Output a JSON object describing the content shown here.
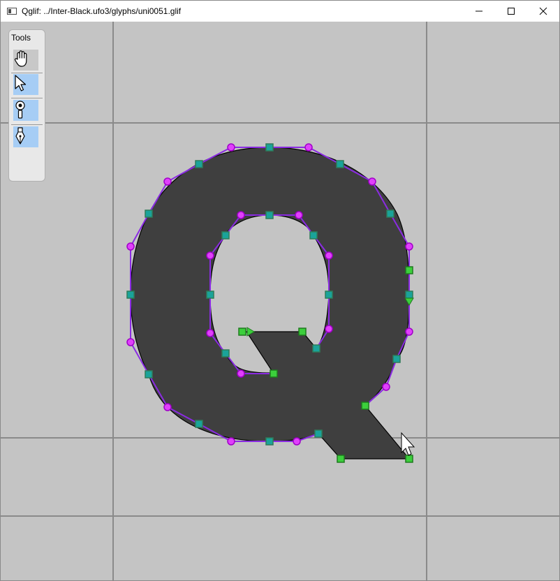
{
  "window": {
    "title": "Qglif: ../Inter-Black.ufo3/glyphs/uni0051.glif",
    "controls": [
      "minimize",
      "maximize",
      "close"
    ]
  },
  "toolbox": {
    "label": "Tools",
    "tools": [
      {
        "name": "hand",
        "icon": "hand-icon",
        "selected": true
      },
      {
        "name": "pointer",
        "icon": "arrow-pointer-icon",
        "selected": false
      },
      {
        "name": "knife",
        "icon": "knife-icon",
        "selected": false
      },
      {
        "name": "pen",
        "icon": "pen-nib-icon",
        "selected": false
      }
    ]
  },
  "editor": {
    "glyph": "uni0051",
    "colors": {
      "background": "#c4c4c4",
      "grid_line": "#8a8a8a",
      "glyph_fill": "#3f3f3f",
      "outline": "#000000",
      "handle_line": "#8a2be2",
      "offcurve_point": "#e040fb",
      "oncurve_point": "#1aa39a",
      "start_point": "#3ccf3c"
    }
  }
}
